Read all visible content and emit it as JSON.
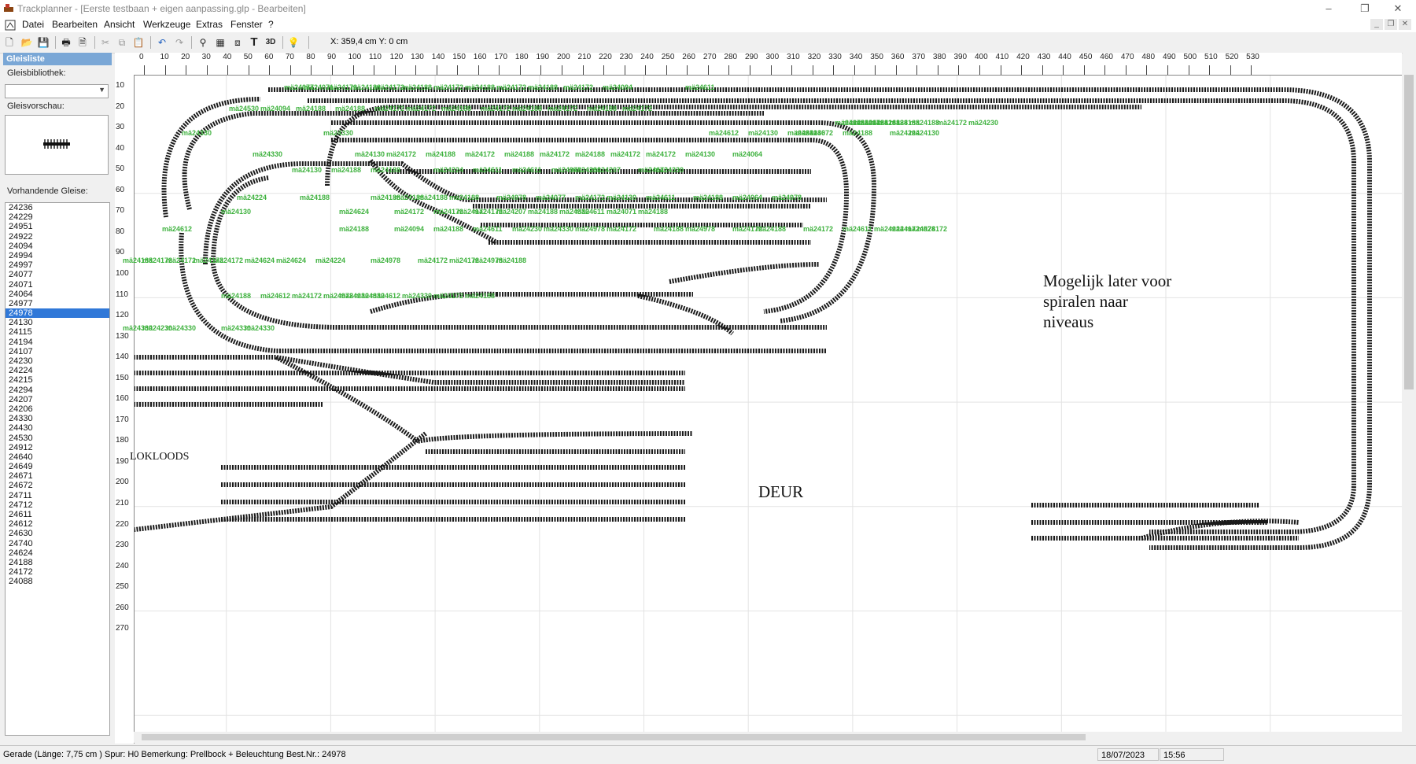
{
  "window": {
    "title": "Trackplanner - [Eerste testbaan + eigen aanpassing.glp - Bearbeiten]",
    "minimize": "–",
    "maximize": "❐",
    "close": "✕"
  },
  "menu": {
    "items": [
      "Datei",
      "Bearbeiten",
      "Ansicht",
      "Werkzeuge",
      "Extras",
      "Fenster",
      "?"
    ]
  },
  "toolbar": {
    "buttons": [
      "new-file-icon",
      "open-folder-icon",
      "save-icon",
      "print-icon",
      "print-preview-icon",
      "cut-icon",
      "copy-icon",
      "paste-icon",
      "undo-icon",
      "redo-icon",
      "track-tool-icon",
      "calculator-icon",
      "window-icon",
      "text-tool-icon",
      "3d-view-icon",
      "help-icon"
    ],
    "label_3d": "3D",
    "label_text": "T",
    "coordinates": "X: 359,4 cm  Y: 0 cm"
  },
  "sidebar": {
    "header": "Gleisliste",
    "library_label": "Gleisbibliothek:",
    "library_value": "",
    "preview_label": "Gleisvorschau:",
    "existing_label": "Vorhandende Gleise:",
    "items": [
      "24236",
      "24229",
      "24951",
      "24922",
      "24094",
      "24994",
      "24997",
      "24077",
      "24071",
      "24064",
      "24977",
      "24978",
      "24130",
      "24115",
      "24194",
      "24107",
      "24230",
      "24224",
      "24215",
      "24294",
      "24207",
      "24206",
      "24330",
      "24430",
      "24530",
      "24912",
      "24640",
      "24649",
      "24671",
      "24672",
      "24711",
      "24712",
      "24611",
      "24612",
      "24630",
      "24740",
      "24624",
      "24188",
      "24172",
      "24088"
    ],
    "selected": "24978"
  },
  "ruler": {
    "top": [
      "0",
      "10",
      "20",
      "30",
      "40",
      "50",
      "60",
      "70",
      "80",
      "90",
      "100",
      "110",
      "120",
      "130",
      "140",
      "150",
      "160",
      "170",
      "180",
      "190",
      "200",
      "210",
      "220",
      "230",
      "240",
      "250",
      "260",
      "270",
      "280",
      "290",
      "300",
      "310",
      "320",
      "330",
      "340",
      "350",
      "360",
      "370",
      "380",
      "390",
      "400",
      "410",
      "420",
      "430",
      "440",
      "450",
      "460",
      "470",
      "480",
      "490",
      "500",
      "510",
      "520",
      "530"
    ],
    "left": [
      "10",
      "20",
      "30",
      "40",
      "50",
      "60",
      "70",
      "80",
      "90",
      "100",
      "110",
      "120",
      "130",
      "140",
      "150",
      "160",
      "170",
      "180",
      "190",
      "200",
      "210",
      "220",
      "230",
      "240",
      "250",
      "260",
      "270"
    ]
  },
  "canvas_text": {
    "note_spiral": [
      "Mogelijk later voor",
      "spiralen naar",
      "niveaus"
    ],
    "lokloods": "LOKLOODS",
    "deur": "DEUR"
  },
  "track_labels": [
    {
      "t": "mä24077"
    },
    {
      "t": "mä24071"
    },
    {
      "t": "mä24172"
    },
    {
      "t": "mä24188"
    },
    {
      "t": "mä24172"
    },
    {
      "t": "mä24188"
    },
    {
      "t": "mä24172"
    },
    {
      "t": "mä24188"
    },
    {
      "t": "mä24172"
    },
    {
      "t": "mä24188"
    },
    {
      "t": "mä24172"
    },
    {
      "t": "mä24094"
    },
    {
      "t": "mä24611"
    },
    {
      "t": "mä24530"
    },
    {
      "t": "mä24094"
    },
    {
      "t": "mä24188"
    },
    {
      "t": "mä24188"
    },
    {
      "t": "mä24172"
    },
    {
      "t": "mä24172"
    },
    {
      "t": "mä24188"
    },
    {
      "t": "mä24172"
    },
    {
      "t": "mä24188"
    },
    {
      "t": "mä24172"
    },
    {
      "t": "mä24188"
    },
    {
      "t": "mä24172"
    },
    {
      "t": "mä24172"
    },
    {
      "t": "mä24330"
    },
    {
      "t": "mä24224"
    },
    {
      "t": "mä24172"
    },
    {
      "t": "mä24188"
    },
    {
      "t": "mä24188"
    },
    {
      "t": "mä24188"
    },
    {
      "t": "mä24188"
    },
    {
      "t": "mä24188"
    },
    {
      "t": "mä24172"
    },
    {
      "t": "mä24230"
    },
    {
      "t": "mä24330"
    },
    {
      "t": "mä24330"
    },
    {
      "t": "mä24612"
    },
    {
      "t": "mä24130"
    },
    {
      "t": "mä24330"
    },
    {
      "t": "mä24130"
    },
    {
      "t": "mä24672"
    },
    {
      "t": "mä24188"
    },
    {
      "t": "mä24224"
    },
    {
      "t": "mä24130"
    },
    {
      "t": "mä24330"
    },
    {
      "t": "mä24130"
    },
    {
      "t": "mä24172"
    },
    {
      "t": "mä24188"
    },
    {
      "t": "mä24172"
    },
    {
      "t": "mä24188"
    },
    {
      "t": "mä24172"
    },
    {
      "t": "mä24188"
    },
    {
      "t": "mä24172"
    },
    {
      "t": "mä24172"
    },
    {
      "t": "mä24130"
    },
    {
      "t": "mä24064"
    },
    {
      "t": "mä24130"
    },
    {
      "t": "mä24188"
    },
    {
      "t": "mä24188"
    },
    {
      "t": "mä24224"
    },
    {
      "t": "mä24611"
    },
    {
      "t": "mä24611"
    },
    {
      "t": "mä24978"
    },
    {
      "t": "mä24230"
    },
    {
      "t": "mä24207"
    },
    {
      "t": "mä24672"
    },
    {
      "t": "mä24330"
    },
    {
      "t": "mä24224"
    },
    {
      "t": "mä24188"
    },
    {
      "t": "mä24188"
    },
    {
      "t": "mä24188"
    },
    {
      "t": "mä24188"
    },
    {
      "t": "mä24188"
    },
    {
      "t": "mä24978"
    },
    {
      "t": "mä24077"
    },
    {
      "t": "mä24172"
    },
    {
      "t": "mä24130"
    },
    {
      "t": "mä24611"
    },
    {
      "t": "mä24188"
    },
    {
      "t": "mä24064"
    },
    {
      "t": "mä24978"
    },
    {
      "t": "mä24130"
    },
    {
      "t": "mä24624"
    },
    {
      "t": "mä24172"
    },
    {
      "t": "mä24172"
    },
    {
      "t": "mä24172"
    },
    {
      "t": "mä24172"
    },
    {
      "t": "mä24207"
    },
    {
      "t": "mä24188"
    },
    {
      "t": "mä24330"
    },
    {
      "t": "mä24611"
    },
    {
      "t": "mä24071"
    },
    {
      "t": "mä24188"
    },
    {
      "t": "mä24612"
    },
    {
      "t": "mä24188"
    },
    {
      "t": "mä24094"
    },
    {
      "t": "mä24188"
    },
    {
      "t": "mä24611"
    },
    {
      "t": "mä24230"
    },
    {
      "t": "mä24330"
    },
    {
      "t": "mä24978"
    },
    {
      "t": "mä24172"
    },
    {
      "t": "mä24188"
    },
    {
      "t": "mä24978"
    },
    {
      "t": "mä24172"
    },
    {
      "t": "mä24188"
    },
    {
      "t": "mä24172"
    },
    {
      "t": "mä24611"
    },
    {
      "t": "mä24224"
    },
    {
      "t": "mä24172"
    },
    {
      "t": "mä24978"
    },
    {
      "t": "mä24172"
    },
    {
      "t": "mä24188"
    },
    {
      "t": "mä24172"
    },
    {
      "t": "mä24172"
    },
    {
      "t": "mä24172"
    },
    {
      "t": "mä24172"
    },
    {
      "t": "mä24624"
    },
    {
      "t": "mä24624"
    },
    {
      "t": "mä24224"
    },
    {
      "t": "mä24978"
    },
    {
      "t": "mä24172"
    },
    {
      "t": "mä24172"
    },
    {
      "t": "mä24978"
    },
    {
      "t": "mä24188"
    },
    {
      "t": "mä24188"
    },
    {
      "t": "mä24612"
    },
    {
      "t": "mä24172"
    },
    {
      "t": "mä24978"
    },
    {
      "t": "mä24230"
    },
    {
      "t": "mä24330"
    },
    {
      "t": "mä24612"
    },
    {
      "t": "mä24330"
    },
    {
      "t": "mä24172"
    },
    {
      "t": "mä24188"
    },
    {
      "t": "mä24330"
    },
    {
      "t": "mä24230"
    },
    {
      "t": "mä24330"
    },
    {
      "t": "mä24330"
    },
    {
      "t": "mä24330"
    }
  ],
  "status": {
    "info": "Gerade (Länge: 7,75 cm ) Spur: H0 Bemerkung: Prellbock + Beleuchtung  Best.Nr.: 24978",
    "date": "18/07/2023",
    "time": "15:56"
  }
}
